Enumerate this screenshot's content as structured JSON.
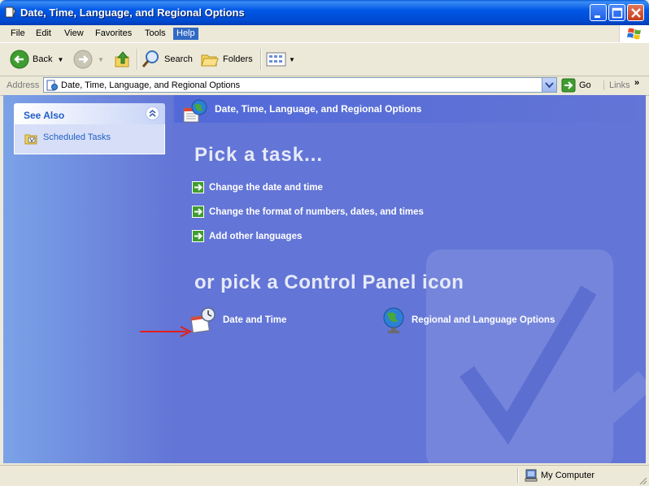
{
  "window": {
    "title": "Date, Time, Language, and Regional Options"
  },
  "menu": {
    "items": [
      "File",
      "Edit",
      "View",
      "Favorites",
      "Tools",
      "Help"
    ],
    "active": "Help"
  },
  "toolbar": {
    "back_label": "Back",
    "search_label": "Search",
    "folders_label": "Folders"
  },
  "address": {
    "label": "Address",
    "value": "Date, Time, Language, and Regional Options",
    "go_label": "Go",
    "links_label": "Links",
    "links_chevron": "»"
  },
  "see_also": {
    "title": "See Also",
    "items": [
      "Scheduled Tasks"
    ]
  },
  "category": {
    "title": "Date, Time, Language, and Regional Options"
  },
  "tasks": {
    "heading": "Pick a task...",
    "items": [
      "Change the date and time",
      "Change the format of numbers, dates, and times",
      "Add other languages"
    ]
  },
  "icons": {
    "heading": "or pick a Control Panel icon",
    "items": [
      "Date and Time",
      "Regional and Language Options"
    ]
  },
  "status": {
    "zone": "My Computer"
  },
  "colors": {
    "title_bar": "#0058e6",
    "content_bg": "#6375d6",
    "link_blue": "#215dc6",
    "annotation_arrow": "#e0201c"
  }
}
